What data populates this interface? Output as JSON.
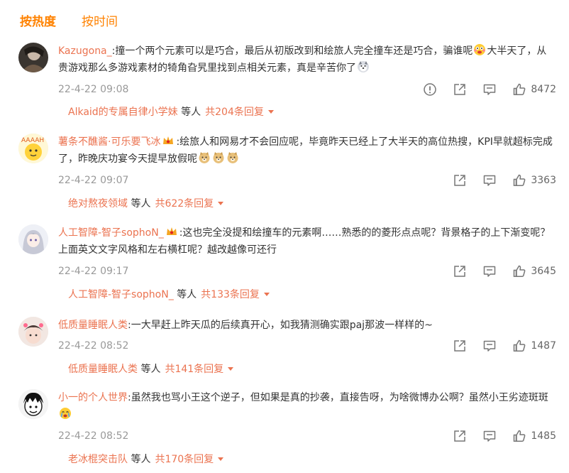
{
  "tabs": {
    "hot": "按热度",
    "time": "按时间"
  },
  "comments": [
    {
      "user": "Kazugona_",
      "text1": ":撞一个两个元素可以是巧合，最后从初版改到和绘旅人完全撞车还是巧合，骗谁呢",
      "text2": "大半天了，从贵游戏那么多游戏素材的犄角旮旯里找到点相关元素，真是辛苦你了",
      "time": "22-4-22 09:08",
      "likes": "8472",
      "reply_user": "Alkaid的专属自律小学妹",
      "reply_mid": "等人",
      "reply_count": "共204条回复"
    },
    {
      "user": "薯条不醮酱·可乐要飞冰",
      "text1": ":绘旅人和网易才不会回应呢，毕竟昨天已经上了大半天的高位热搜，KPI早就超标完成了，昨晚庆功宴今天提早放假呢",
      "time": "22-4-22 09:07",
      "likes": "3363",
      "reply_user": "绝对熬夜领域",
      "reply_mid": "等人",
      "reply_count": "共622条回复"
    },
    {
      "user": "人工智障-智子sophoN_",
      "text1": ":这也完全没提和绘撞车的元素啊……熟悉的的菱形点点呢？背景格子的上下渐变呢？上面英文文字风格和左右横杠呢？越改越像可还行",
      "time": "22-4-22 09:17",
      "likes": "3645",
      "reply_user": "人工智障-智子sophoN_",
      "reply_mid": "等人",
      "reply_count": "共133条回复"
    },
    {
      "user": "低质量睡眠人类",
      "text1": ":一大早赶上昨天瓜的后续真开心，如我猜测确实跟paj那波一样样的~",
      "time": "22-4-22 08:52",
      "likes": "1487",
      "reply_user": "低质量睡眠人类",
      "reply_mid": "等人",
      "reply_count": "共141条回复"
    },
    {
      "user": "小一的个人世界",
      "text1": ":虽然我也骂小王这个逆子，但如果是真的抄袭，直接告呀，为啥微博办公啊？虽然小王劣迹斑斑",
      "time": "22-4-22 08:52",
      "likes": "1485",
      "reply_user": "老冰棍突击队",
      "reply_mid": "等人",
      "reply_count": "共170条回复"
    }
  ],
  "colors": {
    "accent": "#ff8200",
    "username": "#eb7350",
    "meta": "#999999"
  },
  "icons": [
    "report-icon",
    "share-icon",
    "comment-icon",
    "like-icon"
  ]
}
